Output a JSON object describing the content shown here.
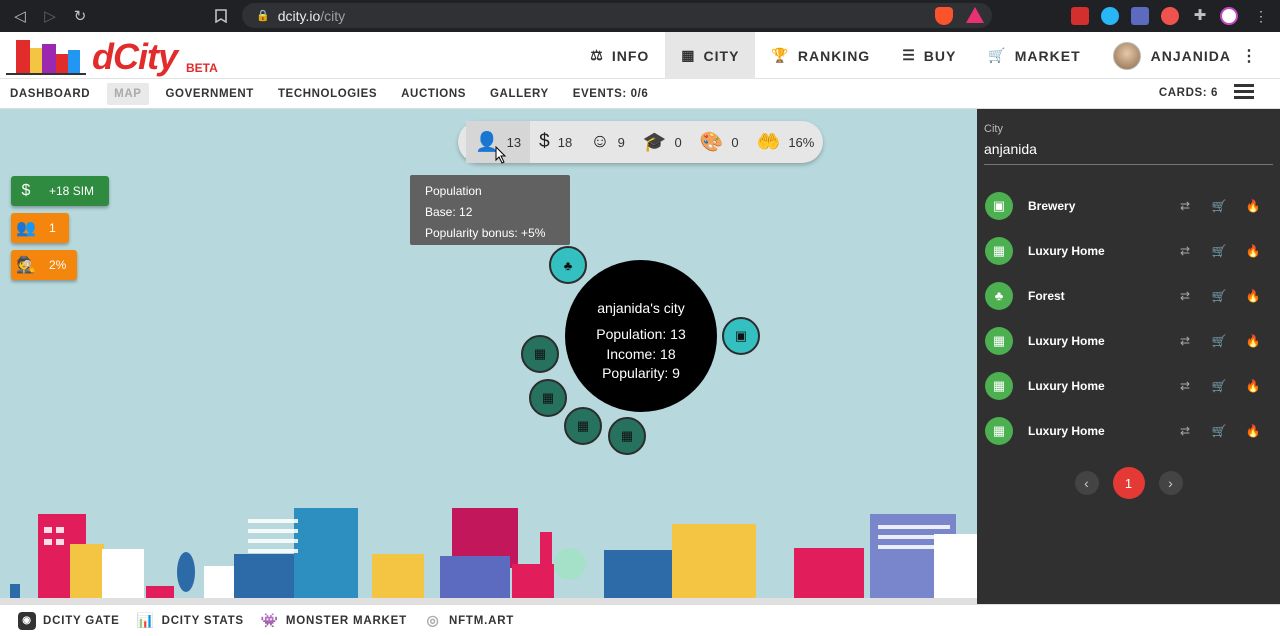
{
  "browser": {
    "url_host": "dcity.io",
    "url_path": "/city"
  },
  "header": {
    "logo_text": "dCity",
    "logo_badge": "BETA",
    "nav": [
      {
        "label": "INFO",
        "icon": "balance-scale-icon"
      },
      {
        "label": "CITY",
        "icon": "city-icon",
        "active": true
      },
      {
        "label": "RANKING",
        "icon": "trophy-icon"
      },
      {
        "label": "BUY",
        "icon": "layers-icon"
      },
      {
        "label": "MARKET",
        "icon": "cart-icon"
      },
      {
        "label": "ANJANIDA",
        "icon": "avatar"
      }
    ]
  },
  "subnav": {
    "items": [
      "DASHBOARD",
      "MAP",
      "GOVERNMENT",
      "TECHNOLOGIES",
      "AUCTIONS",
      "GALLERY",
      "EVENTS: 0/6"
    ],
    "cards": "CARDS: 6"
  },
  "stats": {
    "population": "13",
    "income": "18",
    "popularity": "9",
    "education": "0",
    "creativity": "0",
    "tax": "16%"
  },
  "tooltip": {
    "title": "Population",
    "base": "Base: 12",
    "bonus": "Popularity bonus: +5%"
  },
  "side_buttons": {
    "sim": "+18 SIM",
    "people": "1",
    "crime": "2%",
    "colors": {
      "sim": "#2e8b3f",
      "people": "#f5860d",
      "crime": "#f5860d"
    }
  },
  "city": {
    "name": "anjanida's city",
    "population": "Population: 13",
    "income": "Income: 18",
    "popularity": "Popularity: 9"
  },
  "panel": {
    "field_label": "City",
    "field_value": "anjanida",
    "cards": [
      {
        "name": "Brewery",
        "icon": "beer-mug-icon"
      },
      {
        "name": "Luxury Home",
        "icon": "city-icon"
      },
      {
        "name": "Forest",
        "icon": "tree-icon"
      },
      {
        "name": "Luxury Home",
        "icon": "city-icon"
      },
      {
        "name": "Luxury Home",
        "icon": "city-icon"
      },
      {
        "name": "Luxury Home",
        "icon": "city-icon"
      }
    ],
    "page": "1"
  },
  "footer": {
    "items": [
      "DCITY GATE",
      "DCITY STATS",
      "MONSTER MARKET",
      "NFTM.ART"
    ]
  }
}
